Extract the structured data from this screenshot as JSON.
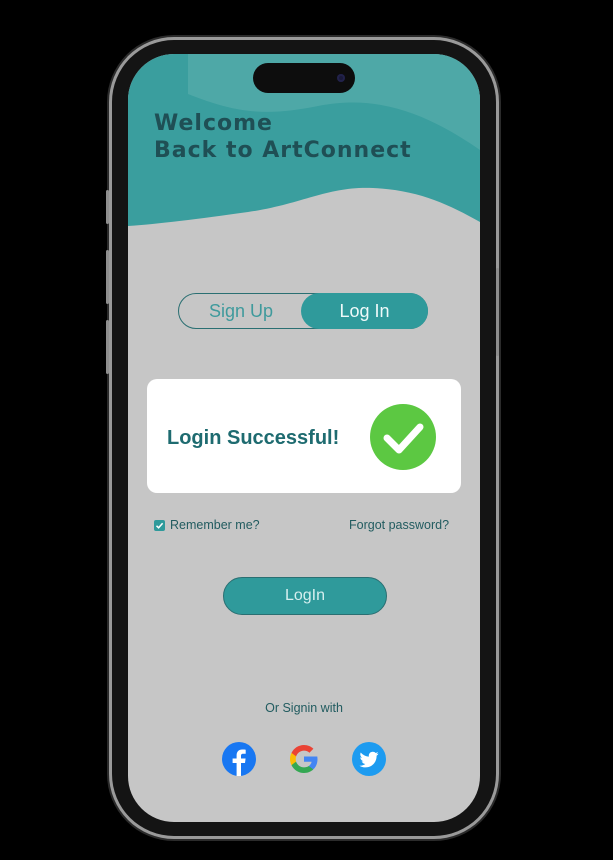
{
  "header": {
    "line1": "Welcome",
    "line2": "Back to ArtConnect"
  },
  "tabs": {
    "signup": "Sign Up",
    "login": "Log In",
    "active": "login"
  },
  "modal": {
    "message": "Login Successful!",
    "icon": "checkmark-icon"
  },
  "options": {
    "remember_label": "Remember me?",
    "remember_checked": true,
    "forgot_label": "Forgot password?"
  },
  "login_button": "LogIn",
  "social": {
    "label": "Or Signin with",
    "providers": [
      "facebook-icon",
      "google-icon",
      "twitter-icon"
    ]
  },
  "colors": {
    "teal": "#2f9a9b",
    "dark_text": "#1f4f55",
    "success_green": "#5cc842",
    "background": "#c6c6c6"
  }
}
